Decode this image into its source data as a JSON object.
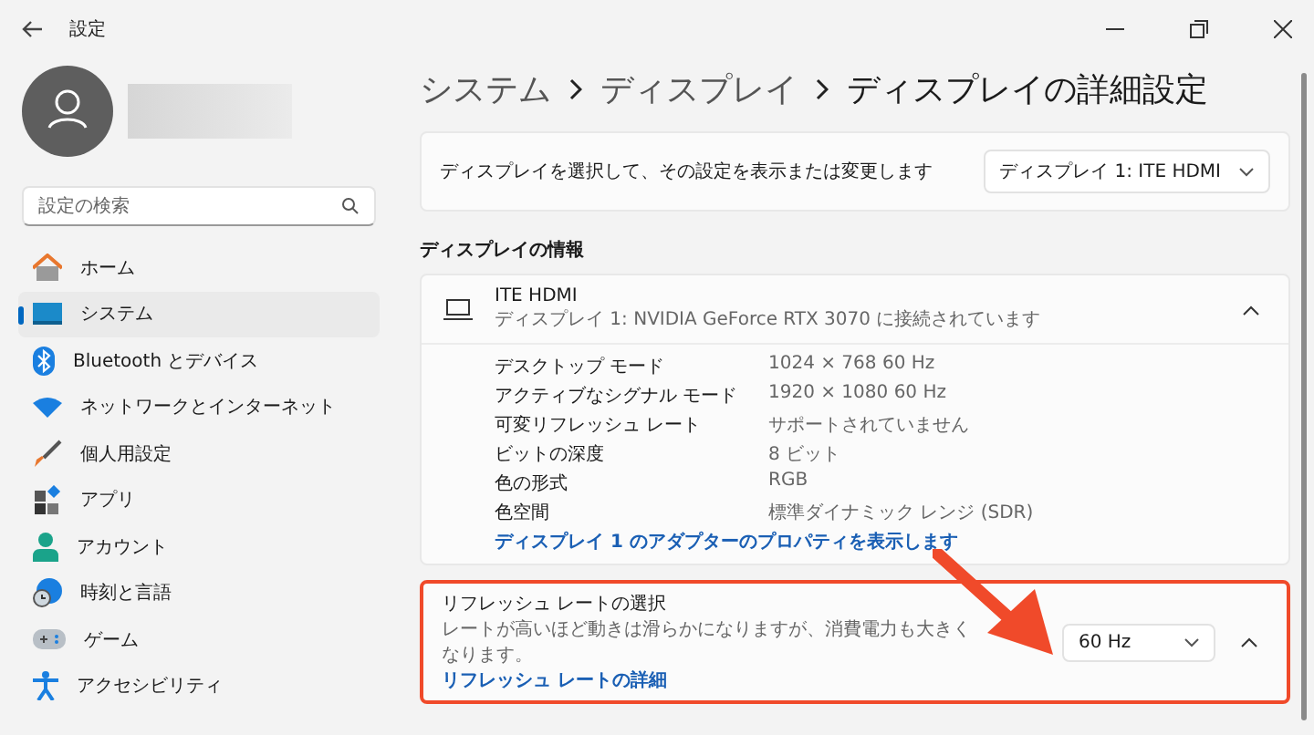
{
  "window": {
    "title": "設定"
  },
  "search": {
    "placeholder": "設定の検索"
  },
  "sidebar": {
    "items": [
      {
        "label": "ホーム",
        "kind": "home",
        "selected": false
      },
      {
        "label": "システム",
        "kind": "system",
        "selected": true
      },
      {
        "label": "Bluetooth とデバイス",
        "kind": "bluetooth",
        "selected": false
      },
      {
        "label": "ネットワークとインターネット",
        "kind": "network",
        "selected": false
      },
      {
        "label": "個人用設定",
        "kind": "brush",
        "selected": false
      },
      {
        "label": "アプリ",
        "kind": "apps",
        "selected": false
      },
      {
        "label": "アカウント",
        "kind": "account",
        "selected": false
      },
      {
        "label": "時刻と言語",
        "kind": "time",
        "selected": false
      },
      {
        "label": "ゲーム",
        "kind": "game",
        "selected": false
      },
      {
        "label": "アクセシビリティ",
        "kind": "accessibility",
        "selected": false
      }
    ]
  },
  "breadcrumb": [
    "システム",
    "ディスプレイ",
    "ディスプレイの詳細設定"
  ],
  "display_select": {
    "label": "ディスプレイを選択して、その設定を表示または変更します",
    "value": "ディスプレイ 1: ITE HDMI"
  },
  "section_title": "ディスプレイの情報",
  "display_info": {
    "name": "ITE HDMI",
    "subtitle": "ディスプレイ 1: NVIDIA GeForce RTX 3070 に接続されています",
    "expanded": true,
    "properties": [
      {
        "label": "デスクトップ モード",
        "value": "1024 × 768 60 Hz"
      },
      {
        "label": "アクティブなシグナル モード",
        "value": "1920 × 1080 60 Hz"
      },
      {
        "label": "可変リフレッシュ レート",
        "value": "サポートされていません"
      },
      {
        "label": "ビットの深度",
        "value": "8 ビット"
      },
      {
        "label": "色の形式",
        "value": "RGB"
      },
      {
        "label": "色空間",
        "value": "標準ダイナミック レンジ (SDR)"
      }
    ],
    "link": "ディスプレイ 1 のアダプターのプロパティを表示します"
  },
  "refresh_rate": {
    "title": "リフレッシュ レートの選択",
    "description": "レートが高いほど動きは滑らかになりますが、消費電力も大きくなります。",
    "link": "リフレッシュ レートの詳細",
    "value": "60 Hz",
    "expanded": true,
    "highlighted": true
  }
}
